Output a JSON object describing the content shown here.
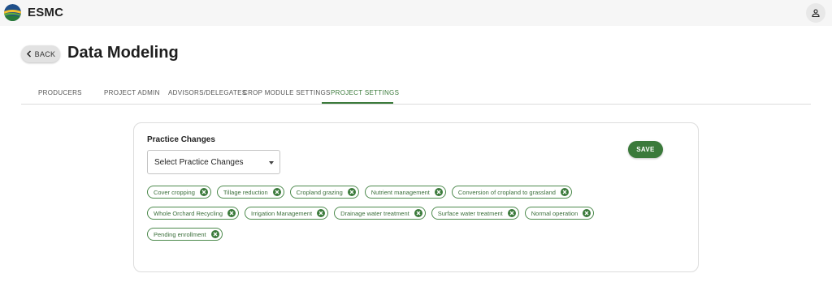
{
  "header": {
    "app_title": "ESMC",
    "logo_icon": "esmc-globe-logo",
    "user_icon": "user-icon"
  },
  "page": {
    "back_label": "BACK",
    "title": "Data Modeling"
  },
  "tabs": [
    {
      "label": "PRODUCERS",
      "active": false
    },
    {
      "label": "PROJECT ADMIN",
      "active": false
    },
    {
      "label": "ADVISORS/DELEGATES",
      "active": false
    },
    {
      "label": "CROP MODULE SETTINGS",
      "active": false
    },
    {
      "label": "PROJECT SETTINGS",
      "active": true
    }
  ],
  "settings": {
    "field_label": "Practice Changes",
    "select_placeholder": "Select Practice Changes",
    "save_label": "SAVE",
    "chips": [
      "Cover cropping",
      "Tillage reduction",
      "Cropland grazing",
      "Nutrient management",
      "Conversion of cropland to grassland",
      "Whole Orchard Recycling",
      "Irrigation Management",
      "Drainage water treatment",
      "Surface water treatment",
      "Normal operation",
      "Pending enrollment"
    ]
  },
  "colors": {
    "accent": "#3b7a3b",
    "topbar": "#f6f6f6"
  }
}
